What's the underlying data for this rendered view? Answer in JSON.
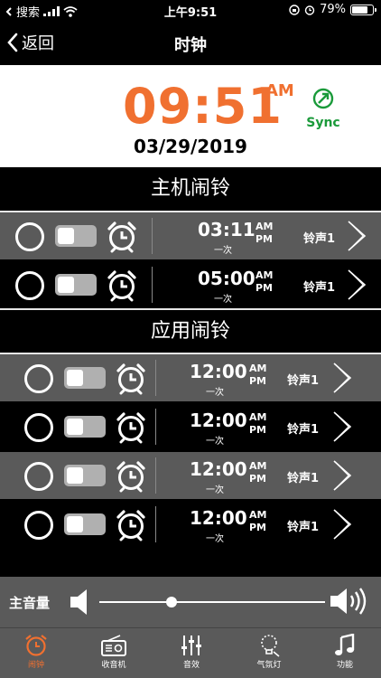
{
  "status": {
    "carrier": "搜索",
    "time": "上午9:51",
    "battery": "79%",
    "battery_level": 0.79
  },
  "nav": {
    "back_label": "返回",
    "title": "时钟"
  },
  "clock": {
    "time": "09:51",
    "ampm": "AM",
    "date": "03/29/2019",
    "sync_label": "Sync"
  },
  "sections": {
    "host": "主机闹铃",
    "app": "应用闹铃"
  },
  "host_alarms": [
    {
      "time": "03:11",
      "am": "AM",
      "pm": "PM",
      "repeat": "一次",
      "ringtone": "铃声1"
    },
    {
      "time": "05:00",
      "am": "AM",
      "pm": "PM",
      "repeat": "一次",
      "ringtone": "铃声1"
    }
  ],
  "app_alarms": [
    {
      "time": "12:00",
      "am": "AM",
      "pm": "PM",
      "repeat": "一次",
      "ringtone": "铃声1"
    },
    {
      "time": "12:00",
      "am": "AM",
      "pm": "PM",
      "repeat": "一次",
      "ringtone": "铃声1"
    },
    {
      "time": "12:00",
      "am": "AM",
      "pm": "PM",
      "repeat": "一次",
      "ringtone": "铃声1"
    },
    {
      "time": "12:00",
      "am": "AM",
      "pm": "PM",
      "repeat": "一次",
      "ringtone": "铃声1"
    }
  ],
  "volume": {
    "label": "主音量",
    "level": 0.32
  },
  "tabs": [
    {
      "label": "闹钟",
      "icon": "alarm-clock-icon",
      "active": true
    },
    {
      "label": "收音机",
      "icon": "radio-icon",
      "active": false
    },
    {
      "label": "音效",
      "icon": "equalizer-icon",
      "active": false
    },
    {
      "label": "气氛灯",
      "icon": "lamp-icon",
      "active": false
    },
    {
      "label": "功能",
      "icon": "music-note-icon",
      "active": false
    }
  ],
  "colors": {
    "accent": "#f07030",
    "sync": "#1a9a3a",
    "row_gray": "#5a5a5a"
  }
}
